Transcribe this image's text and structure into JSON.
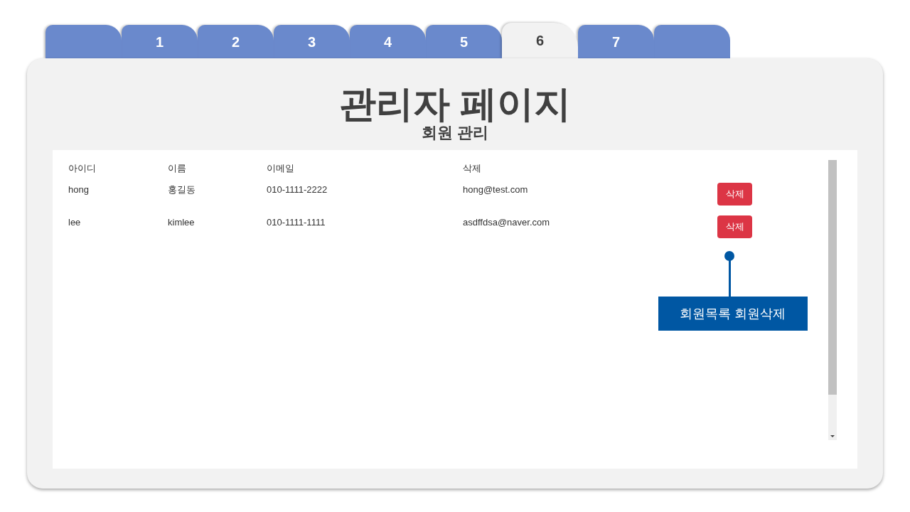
{
  "tabs": [
    {
      "selected": false
    },
    {
      "label": "1",
      "selected": false
    },
    {
      "label": "2",
      "selected": false
    },
    {
      "label": "3",
      "selected": false
    },
    {
      "label": "4",
      "selected": false
    },
    {
      "label": "5",
      "selected": false
    },
    {
      "label": "6",
      "selected": true
    },
    {
      "label": "7",
      "selected": false
    },
    {
      "selected": false
    }
  ],
  "title": "관리자 페이지",
  "subtitle": "회원 관리",
  "table": {
    "columns": [
      "아이디",
      "이름",
      "이메일",
      "삭제"
    ],
    "rows": [
      {
        "cells": [
          "hong",
          "홍길동",
          "010-1111-2222",
          "hong@test.com"
        ],
        "button": "삭제"
      },
      {
        "cells": [
          "lee",
          "kimlee",
          "010-1111-1111",
          "asdffdsa@naver.com"
        ],
        "button": "삭제"
      }
    ]
  },
  "callout": {
    "text": "회원목록 회원삭제"
  }
}
